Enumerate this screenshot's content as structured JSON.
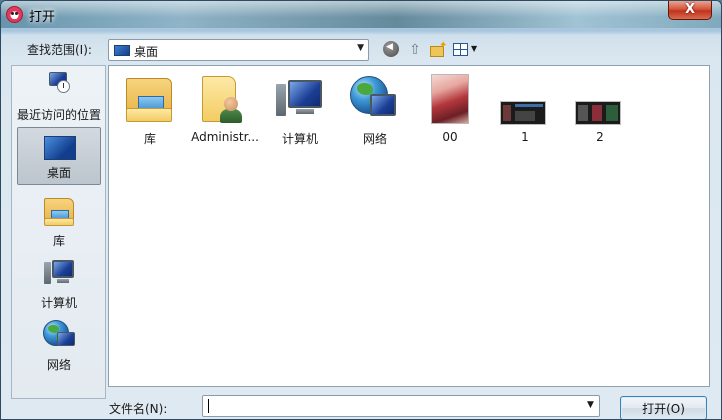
{
  "window": {
    "title": "打开",
    "close_label": "X"
  },
  "toolbar": {
    "look_in_label": "查找范围(I):",
    "look_in_value": "桌面"
  },
  "places": [
    {
      "label": "最近访问的位置"
    },
    {
      "label": "桌面"
    },
    {
      "label": "库"
    },
    {
      "label": "计算机"
    },
    {
      "label": "网络"
    }
  ],
  "files": [
    {
      "label": "库"
    },
    {
      "label": "Administr..."
    },
    {
      "label": "计算机"
    },
    {
      "label": "网络"
    },
    {
      "label": "00"
    },
    {
      "label": "1"
    },
    {
      "label": "2"
    }
  ],
  "footer": {
    "filename_label": "文件名(N):",
    "filename_value": "",
    "open_label": "打开(O)"
  }
}
